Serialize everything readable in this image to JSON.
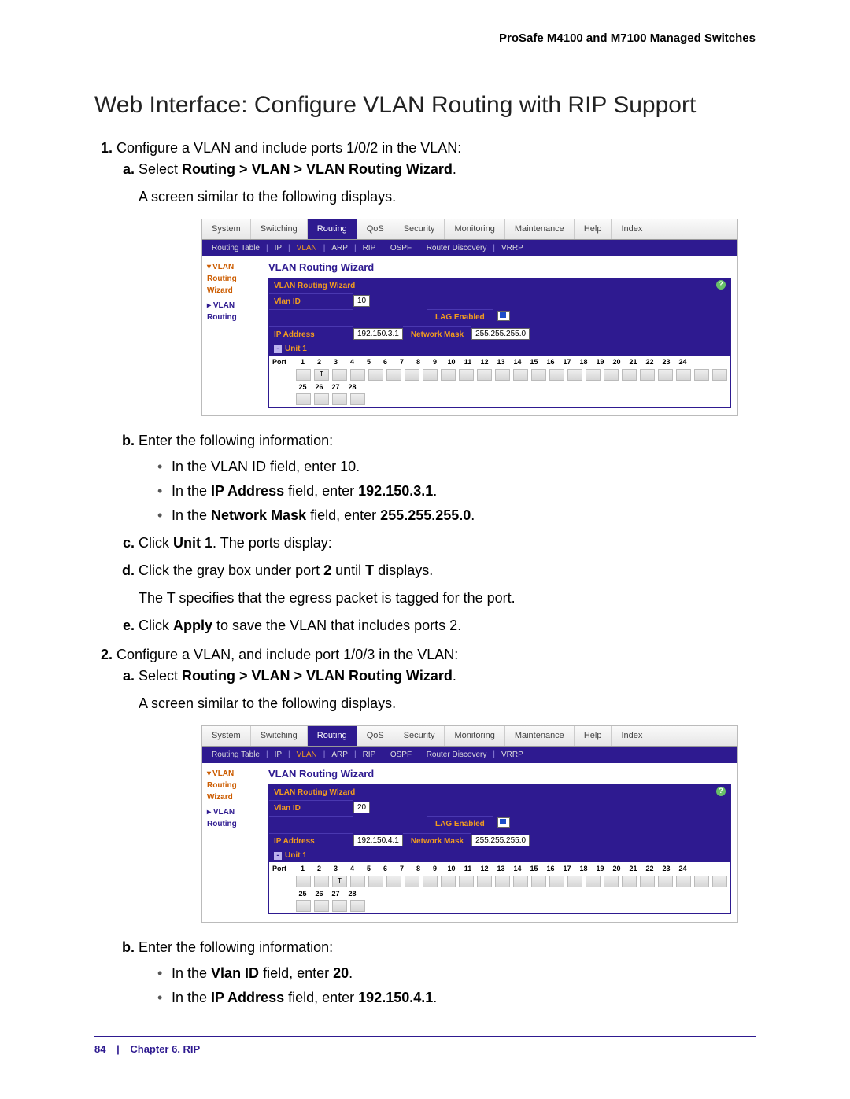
{
  "doc_header": "ProSafe M4100 and M7100 Managed Switches",
  "section_title": "Web Interface: Configure VLAN Routing with RIP Support",
  "steps": {
    "s1": "Configure a VLAN and include ports 1/0/2 in the VLAN:",
    "s1a_pre": "Select ",
    "s1a_bold": "Routing > VLAN > VLAN Routing Wizard",
    "s1a_post": ".",
    "s1a_line2": "A screen similar to the following displays.",
    "s1b": "Enter the following information:",
    "s1b_i1_pre": "In the VLAN ID field, enter 10.",
    "s1b_i2_pre": "In the ",
    "s1b_i2_bold": "IP Address",
    "s1b_i2_mid": " field, enter ",
    "s1b_i2_val": "192.150.3.1",
    "s1b_i3_pre": "In the ",
    "s1b_i3_bold": "Network Mask",
    "s1b_i3_mid": " field, enter ",
    "s1b_i3_val": "255.255.255.0",
    "s1c_pre": "Click ",
    "s1c_bold": "Unit 1",
    "s1c_post": ". The ports display:",
    "s1d_pre": "Click the gray box under port ",
    "s1d_b1": "2",
    "s1d_mid": " until ",
    "s1d_b2": "T",
    "s1d_post": " displays.",
    "s1d_line2": "The T specifies that the egress packet is tagged for the port.",
    "s1e_pre": "Click ",
    "s1e_bold": "Apply",
    "s1e_post": " to save the VLAN that includes ports 2.",
    "s2": "Configure a VLAN, and include port 1/0/3 in the VLAN:",
    "s2a_pre": "Select ",
    "s2a_bold": "Routing > VLAN > VLAN Routing Wizard",
    "s2a_post": ".",
    "s2a_line2": "A screen similar to the following displays.",
    "s2b": "Enter the following information:",
    "s2b_i1_pre": "In the ",
    "s2b_i1_bold": "Vlan ID",
    "s2b_i1_mid": " field, enter ",
    "s2b_i1_val": "20",
    "s2b_i2_pre": "In the ",
    "s2b_i2_bold": "IP Address",
    "s2b_i2_mid": " field, enter ",
    "s2b_i2_val": "192.150.4.1"
  },
  "ui": {
    "tabs": [
      "System",
      "Switching",
      "Routing",
      "QoS",
      "Security",
      "Monitoring",
      "Maintenance",
      "Help",
      "Index"
    ],
    "subtabs": [
      "Routing Table",
      "IP",
      "VLAN",
      "ARP",
      "RIP",
      "OSPF",
      "Router Discovery",
      "VRRP"
    ],
    "leftnav": {
      "wizard": "VLAN Routing Wizard",
      "routing": "VLAN Routing"
    },
    "panel_title": "VLAN Routing Wizard",
    "form_header": "VLAN Routing Wizard",
    "labels": {
      "vlan_id": "Vlan ID",
      "ip_address": "IP Address",
      "lag_enabled": "LAG Enabled",
      "network_mask": "Network Mask",
      "unit1": "Unit 1",
      "port": "Port"
    },
    "shot1": {
      "vlan_id": "10",
      "ip": "192.150.3.1",
      "mask": "255.255.255.0",
      "t_port": 2
    },
    "shot2": {
      "vlan_id": "20",
      "ip": "192.150.4.1",
      "mask": "255.255.255.0",
      "t_port": 3
    },
    "port_row1": [
      "1",
      "2",
      "3",
      "4",
      "5",
      "6",
      "7",
      "8",
      "9",
      "10",
      "11",
      "12",
      "13",
      "14",
      "15",
      "16",
      "17",
      "18",
      "19",
      "20",
      "21",
      "22",
      "23",
      "24"
    ],
    "port_row2": [
      "25",
      "26",
      "27",
      "28"
    ]
  },
  "footer": {
    "page": "84",
    "sep": "|",
    "chapter": "Chapter 6.  RIP"
  }
}
